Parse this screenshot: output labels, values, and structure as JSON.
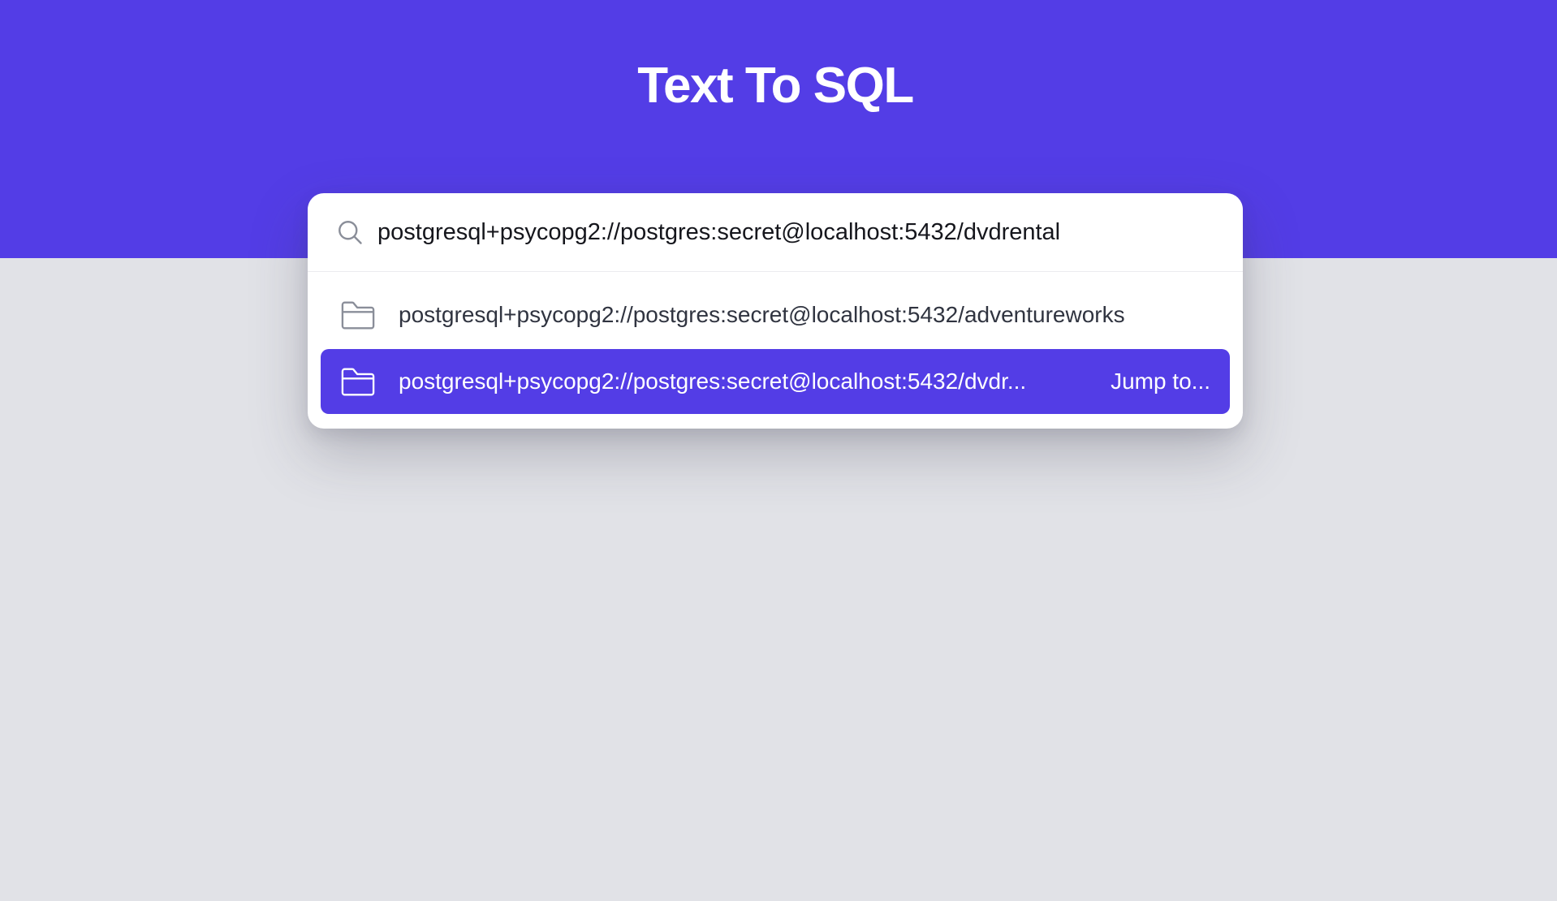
{
  "header": {
    "title": "Text To SQL"
  },
  "search": {
    "value": "postgresql+psycopg2://postgres:secret@localhost:5432/dvdrental",
    "icon": "search-icon"
  },
  "results": [
    {
      "icon": "folder-icon",
      "label": "postgresql+psycopg2://postgres:secret@localhost:5432/adventureworks",
      "selected": false
    },
    {
      "icon": "folder-icon",
      "label": "postgresql+psycopg2://postgres:secret@localhost:5432/dvdr...",
      "selected": true,
      "hint": "Jump to..."
    }
  ],
  "colors": {
    "accent": "#533de6",
    "background": "#e1e2e7",
    "surface": "#ffffff",
    "text": "#303440",
    "icon": "#8a8e99"
  }
}
